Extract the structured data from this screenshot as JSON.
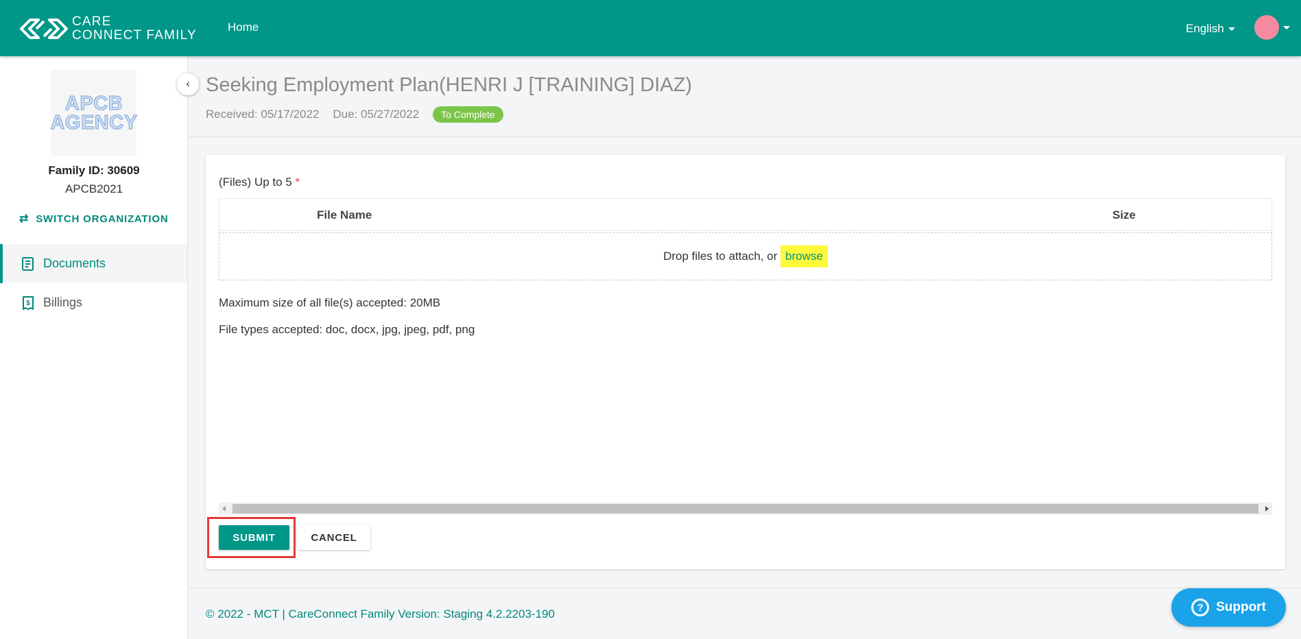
{
  "brand": {
    "line1": "CARE",
    "line2": "CONNECT FAMILY",
    "primary_color": "#009688",
    "logo_icon": "chain-link-icon"
  },
  "nav": {
    "home": "Home",
    "language": "English"
  },
  "sidebar": {
    "agency_logo_line1": "APCB",
    "agency_logo_line2": "AGENCY",
    "family_id": "Family ID: 30609",
    "family_code": "APCB2021",
    "switch_org": "SWITCH ORGANIZATION",
    "items": [
      {
        "label": "Documents",
        "icon": "document-icon",
        "active": true
      },
      {
        "label": "Billings",
        "icon": "receipt-dollar-icon",
        "active": false
      }
    ]
  },
  "header": {
    "title": "Seeking Employment Plan(HENRI J [TRAINING] DIAZ)",
    "received": "Received: 05/17/2022",
    "due": "Due: 05/27/2022",
    "status": "To Complete",
    "status_color": "#7cc54a"
  },
  "upload": {
    "label": "(Files) Up to 5",
    "required_mark": "*",
    "columns": [
      "File Name",
      "Size"
    ],
    "drop_text": "Drop files to attach, or",
    "browse": "browse",
    "max_size": "Maximum size of all file(s) accepted: 20MB",
    "file_types": "File types accepted: doc, docx, jpg, jpeg, pdf, png"
  },
  "actions": {
    "submit": "SUBMIT",
    "cancel": "CANCEL"
  },
  "footer": {
    "text": "© 2022 - MCT | CareConnect Family Version: Staging 4.2.2203-190",
    "support": "Support"
  }
}
